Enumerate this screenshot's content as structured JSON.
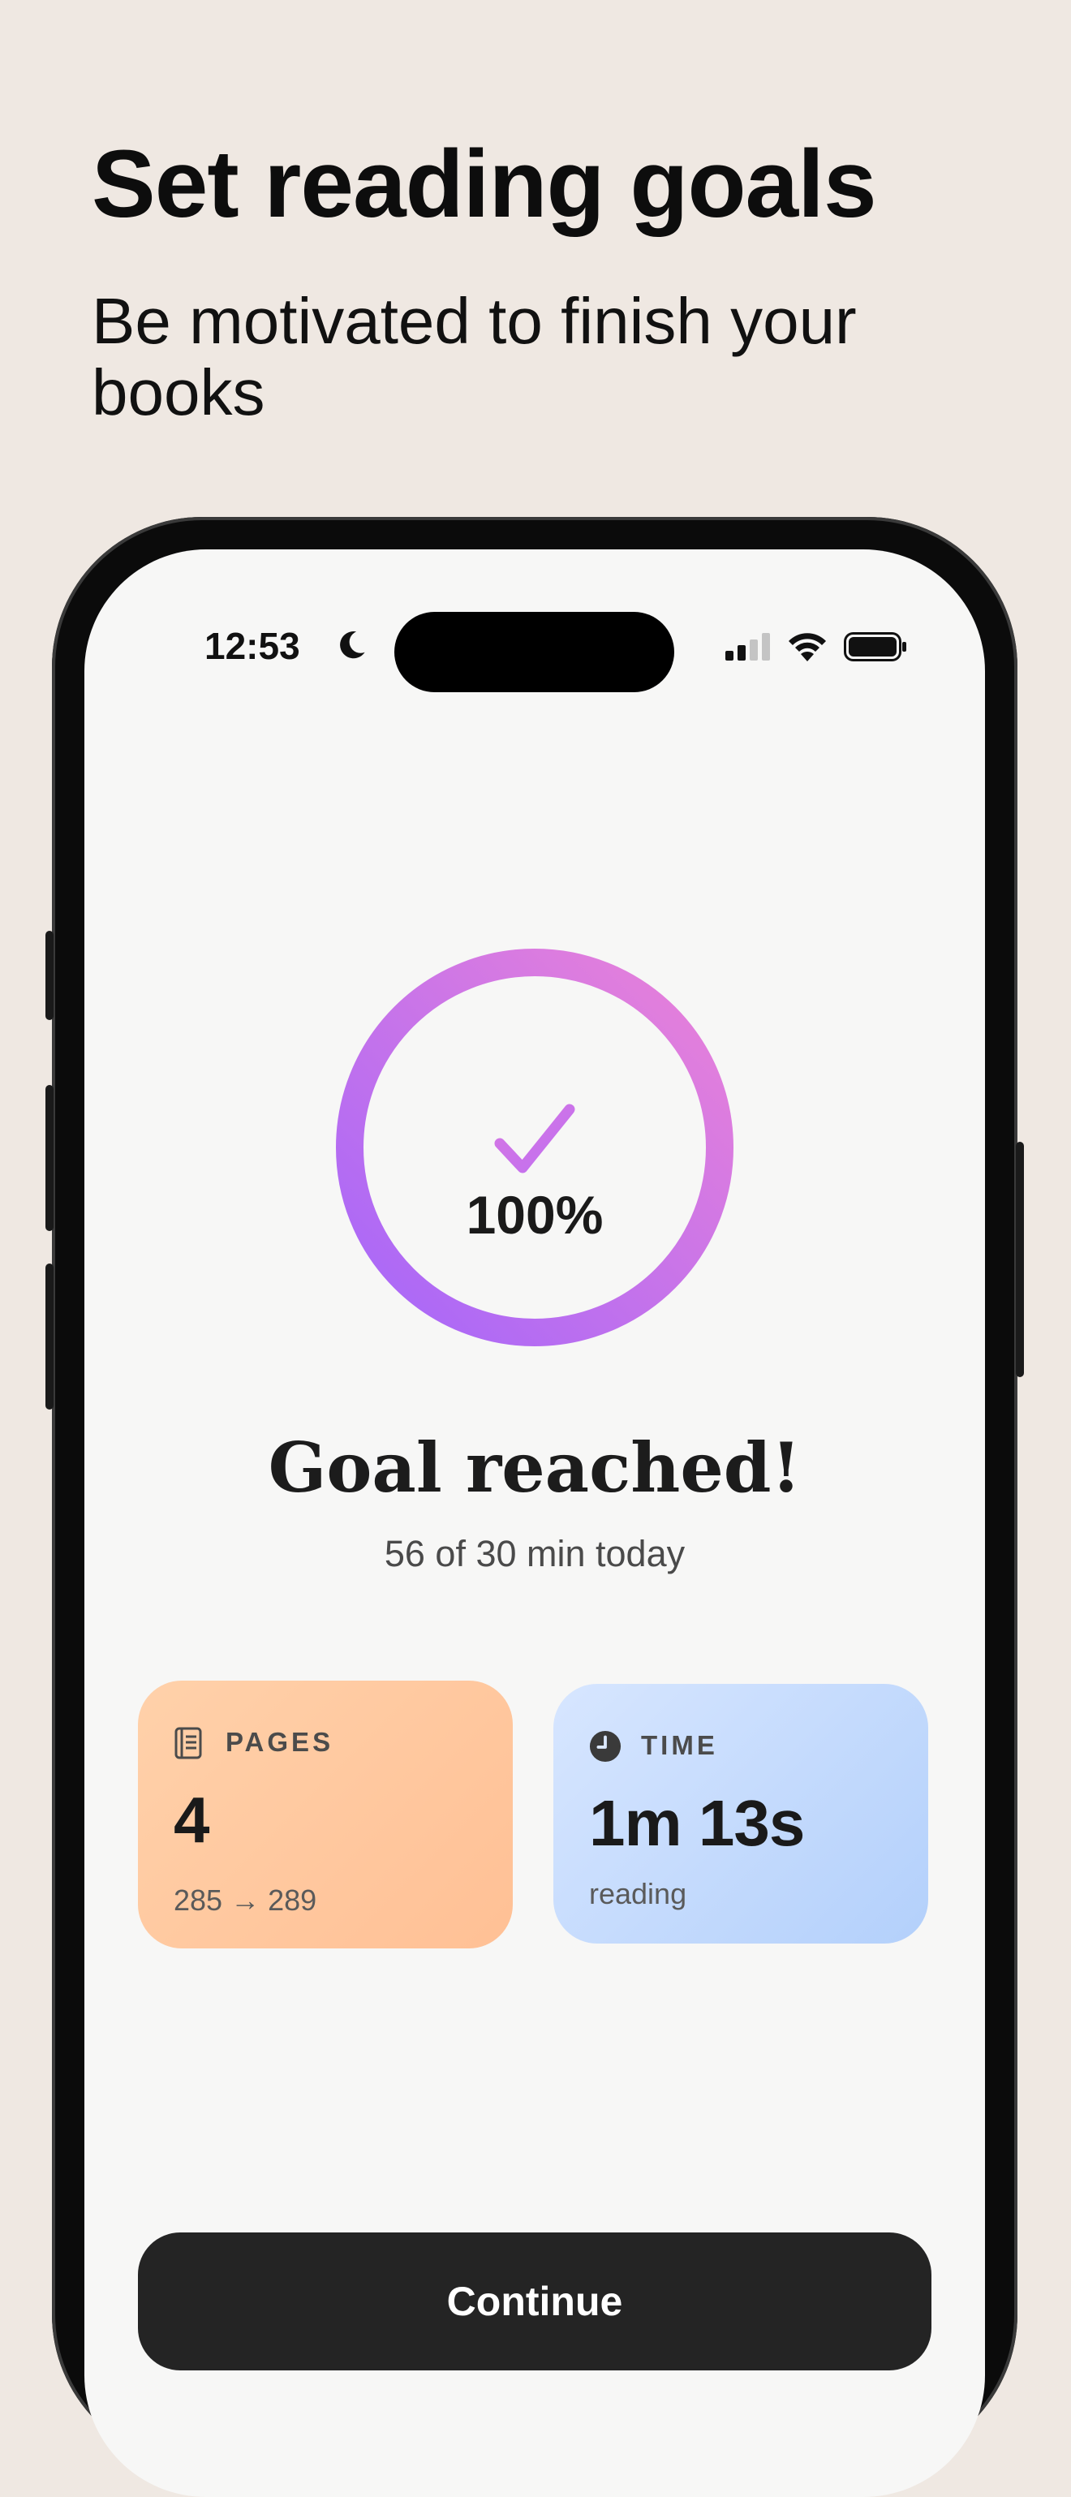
{
  "promo": {
    "headline": "Set reading goals",
    "subheadline": "Be motivated to finish your books"
  },
  "status_bar": {
    "time": "12:53",
    "focus_icon": "moon-icon",
    "signal_icon": "cellular-signal-icon",
    "wifi_icon": "wifi-icon",
    "battery_icon": "battery-icon"
  },
  "progress": {
    "percent_label": "100%",
    "fraction": 1.0,
    "check_icon": "checkmark-icon",
    "gradient_colors": [
      "#e47fdc",
      "#a767f7"
    ]
  },
  "goal": {
    "title": "Goal reached!",
    "subtitle": "56 of 30 min today"
  },
  "stats": {
    "pages": {
      "icon": "book-pages-icon",
      "label": "PAGES",
      "value": "4",
      "detail": "285 → 289",
      "color": "#ffc59c"
    },
    "time": {
      "icon": "clock-icon",
      "label": "TIME",
      "value": "1m 13s",
      "detail": "reading",
      "color": "#c5dcfd"
    }
  },
  "actions": {
    "continue_label": "Continue"
  }
}
